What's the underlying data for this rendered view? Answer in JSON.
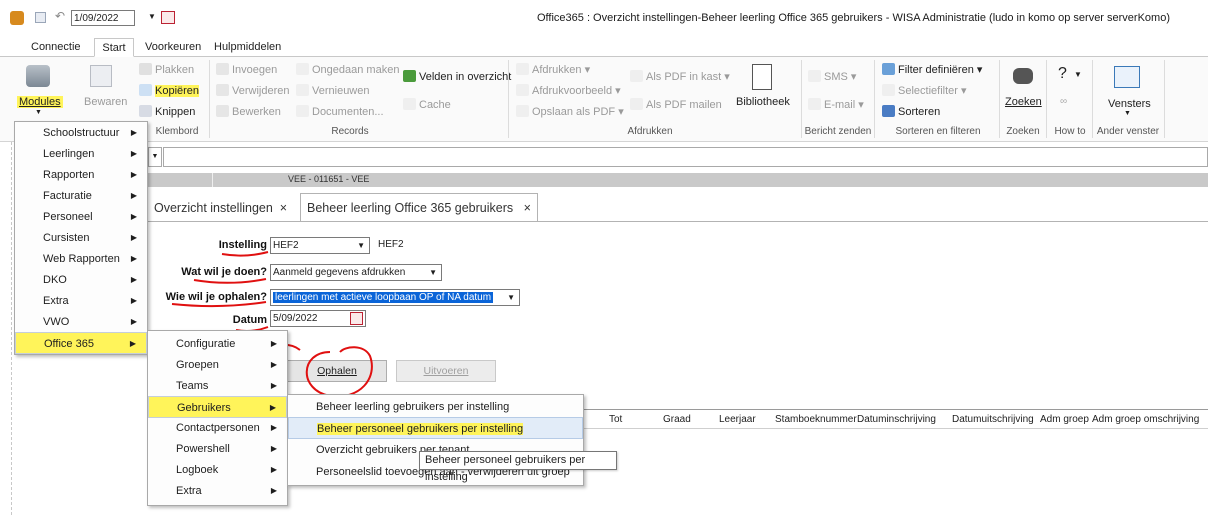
{
  "window": {
    "title": "Office365 : Overzicht instellingen-Beheer leerling Office 365 gebruikers  - WISA Administratie (ludo in komo op server serverKomo)",
    "quick_date": "1/09/2022"
  },
  "ribbon_tabs": [
    "Connectie",
    "Start",
    "Voorkeuren",
    "Hulpmiddelen"
  ],
  "ribbon": {
    "modules": "Modules",
    "bewaren": "Bewaren",
    "plakken": "Plakken",
    "kopieren": "Kopiëren",
    "knippen": "Knippen",
    "klembord": "Klembord",
    "invoegen": "Invoegen",
    "verwijderen": "Verwijderen",
    "bewerken": "Bewerken",
    "ongedaan": "Ongedaan maken",
    "vernieuwen": "Vernieuwen",
    "documenten": "Documenten...",
    "velden": "Velden in overzicht",
    "cache": "Cache",
    "records": "Records",
    "afdrukken": "Afdrukken",
    "afdrukvoorbeeld": "Afdrukvoorbeeld",
    "opslaan_pdf": "Opslaan als PDF",
    "pdf_kast": "Als PDF in kast",
    "pdf_mailen": "Als PDF mailen",
    "bibliotheek": "Bibliotheek",
    "afdrukken_grp": "Afdrukken",
    "sms": "SMS",
    "email": "E-mail",
    "bericht": "Bericht zenden",
    "filter": "Filter definiëren",
    "selectiefilter": "Selectiefilter",
    "sorteren": "Sorteren",
    "sorteren_grp": "Sorteren en filteren",
    "zoeken": "Zoeken",
    "zoeken_grp": "Zoeken",
    "howto": "How to",
    "vensters": "Vensters",
    "ander_venster": "Ander venster"
  },
  "menu_modules": [
    "Schoolstructuur",
    "Leerlingen",
    "Rapporten",
    "Facturatie",
    "Personeel",
    "Cursisten",
    "Web Rapporten",
    "DKO",
    "Extra",
    "VWO",
    "Office 365"
  ],
  "menu_office365": [
    "Configuratie",
    "Groepen",
    "Teams",
    "Gebruikers",
    "Contactpersonen",
    "Powershell",
    "Logboek",
    "Extra"
  ],
  "menu_gebruikers": [
    "Beheer leerling gebruikers per instelling",
    "Beheer personeel gebruikers per instelling",
    "Overzicht gebruikers per tenant",
    "Personeelslid toevoegen aan - verwijderen uit groep"
  ],
  "tooltip": "Beheer personeel gebruikers per instelling",
  "band_text": "VEE - 011651 - VEE",
  "doc_tabs": [
    {
      "label": "Overzicht instellingen",
      "close": "×"
    },
    {
      "label": "Beheer leerling Office 365 gebruikers",
      "close": "×"
    }
  ],
  "form": {
    "instelling_label": "Instelling",
    "instelling_value": "HEF2",
    "instelling_text": "HEF2",
    "wat_label": "Wat wil je doen?",
    "wat_value": "Aanmeld gegevens afdrukken",
    "wie_label": "Wie wil je ophalen?",
    "wie_value": "leerlingen met actieve loopbaan OP of NA datum",
    "datum_label": "Datum",
    "datum_value": "5/09/2022",
    "ophalen": "Ophalen",
    "uitvoeren": "Uitvoeren"
  },
  "columns": [
    "Tot",
    "Graad",
    "Leerjaar",
    "Stamboeknummer",
    "Datuminschrijving",
    "Datumuitschrijving",
    "Adm groep",
    "Adm groep omschrijving"
  ],
  "colors": {
    "highlight": "#fff45a",
    "annotation": "#e01010",
    "selection": "#0a64d8"
  }
}
